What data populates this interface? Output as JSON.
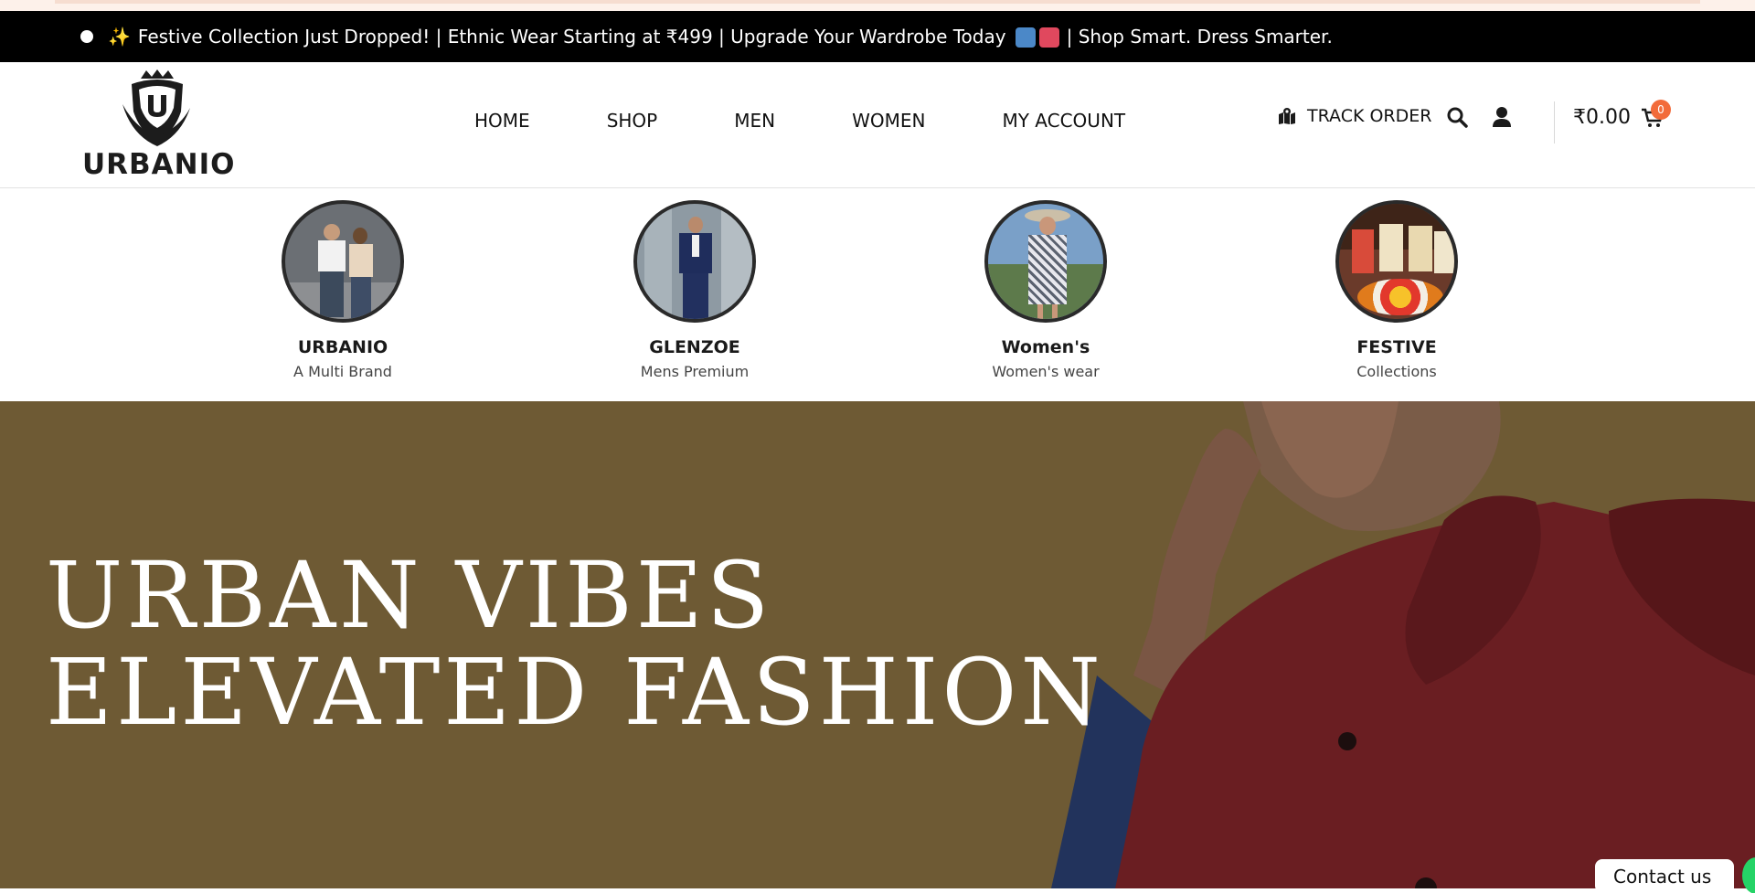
{
  "announcement": {
    "text_a": "Festive Collection Just Dropped! | Ethnic Wear Starting at ₹499 | Upgrade Your Wardrobe Today",
    "text_b": "| Shop Smart. Dress Smarter."
  },
  "brand": {
    "name": "URBANIO"
  },
  "nav": {
    "items": [
      {
        "label": "HOME"
      },
      {
        "label": "SHOP"
      },
      {
        "label": "MEN"
      },
      {
        "label": "WOMEN"
      },
      {
        "label": "MY ACCOUNT"
      }
    ]
  },
  "header_actions": {
    "track_order": "TRACK ORDER",
    "cart_total": "₹0.00",
    "cart_count": "0"
  },
  "categories": [
    {
      "title": "URBANIO",
      "subtitle": "A Multi Brand"
    },
    {
      "title": "GLENZOE",
      "subtitle": "Mens Premium"
    },
    {
      "title": "Women's",
      "subtitle": "Women's wear"
    },
    {
      "title": "FESTIVE",
      "subtitle": "Collections"
    }
  ],
  "hero": {
    "line1": "URBAN VIBES",
    "line2": "ELEVATED FASHION"
  },
  "contact": {
    "label": "Contact us"
  },
  "colors": {
    "announcement_bg": "#000000",
    "hero_bg": "#6e5a34",
    "cart_badge": "#f26b3a",
    "whatsapp": "#25d366"
  }
}
